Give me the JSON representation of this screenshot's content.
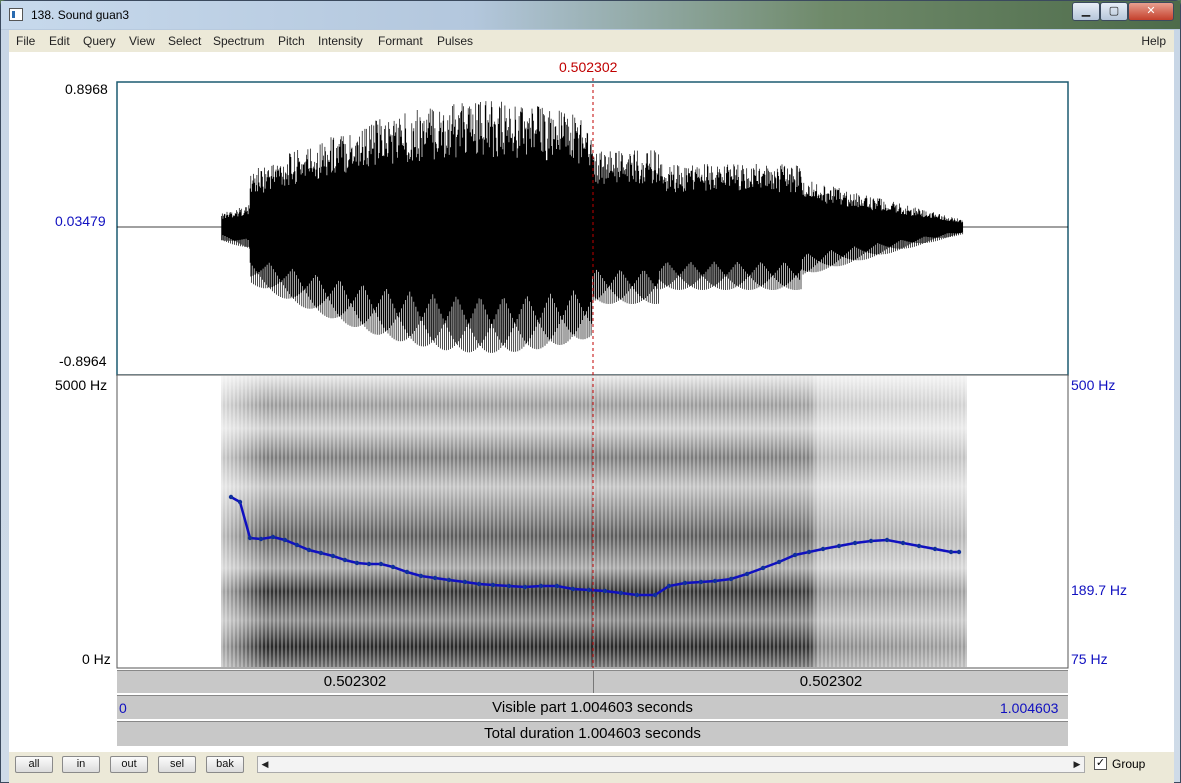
{
  "window": {
    "title": "138. Sound guan3"
  },
  "menu": {
    "items": [
      "File",
      "Edit",
      "Query",
      "View",
      "Select",
      "Spectrum",
      "Pitch",
      "Intensity",
      "Formant",
      "Pulses"
    ],
    "help": "Help"
  },
  "cursor": {
    "time": "0.502302"
  },
  "waveform": {
    "ymax": "0.8968",
    "ymid": "0.03479",
    "ymin": "-0.8964"
  },
  "spectrogram": {
    "fmax": "5000 Hz",
    "fmin": "0 Hz"
  },
  "pitch": {
    "max": "500 Hz",
    "value": "189.7 Hz",
    "min": "75 Hz"
  },
  "bars": {
    "left_time": "0.502302",
    "right_time": "0.502302",
    "visible_start": "0",
    "visible_text": "Visible part 1.004603 seconds",
    "visible_end": "1.004603",
    "total_text": "Total duration 1.004603 seconds"
  },
  "toolbar": {
    "buttons": [
      "all",
      "in",
      "out",
      "sel",
      "bak"
    ],
    "group_label": "Group",
    "group_checked": true
  },
  "colors": {
    "cursor": "#c00000",
    "pitch": "#1010c0",
    "waveform": "#000000"
  }
}
